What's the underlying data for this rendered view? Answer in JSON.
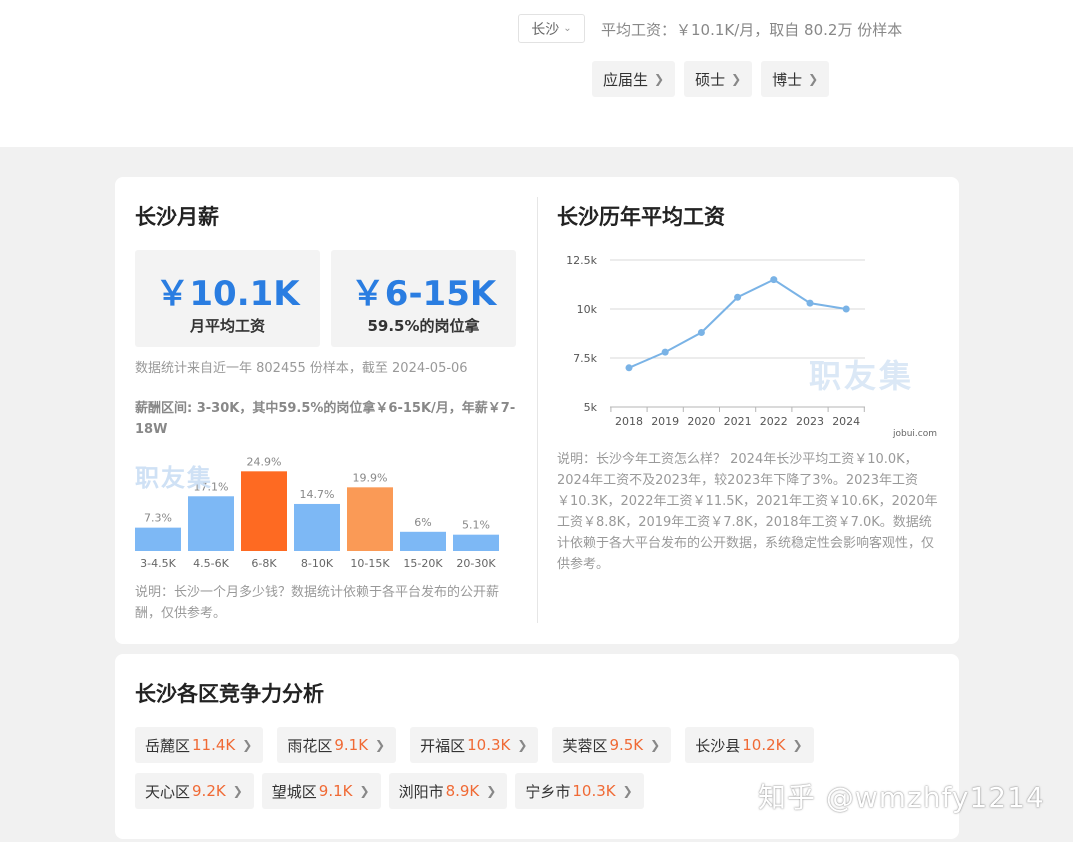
{
  "header": {
    "city": "长沙",
    "summary": "平均工资：￥10.1K/月，取自 80.2万 份样本",
    "filters": [
      "应届生",
      "硕士",
      "博士"
    ]
  },
  "monthly": {
    "title": "长沙月薪",
    "avg_value": "￥10.1K",
    "avg_label": "月平均工资",
    "range_value": "￥6-15K",
    "range_label": "59.5%的岗位拿",
    "source_note": "数据统计来自近一年 802455 份样本，截至 2024-05-06",
    "range_text": "薪酬区间: 3-30K，其中59.5%的岗位拿￥6-15K/月，年薪￥7-18W",
    "watermark": "职友集",
    "footnote": "说明：长沙一个月多少钱？数据统计依赖于各平台发布的公开薪酬，仅供参考。"
  },
  "history": {
    "title": "长沙历年平均工资",
    "watermark": "职友集",
    "source_label": "jobui.com",
    "note": "说明：长沙今年工资怎么样？ 2024年长沙平均工资￥10.0K，2024年工资不及2023年，较2023年下降了3%。2023年工资￥10.3K，2022年工资￥11.5K，2021年工资￥10.6K，2020年工资￥8.8K，2019年工资￥7.8K，2018年工资￥7.0K。数据统计依赖于各大平台发布的公开数据，系统稳定性会影响客观性，仅供参考。"
  },
  "chart_data": [
    {
      "type": "bar",
      "categories": [
        "3-4.5K",
        "4.5-6K",
        "6-8K",
        "8-10K",
        "10-15K",
        "15-20K",
        "20-30K"
      ],
      "values": [
        7.3,
        17.1,
        24.9,
        14.7,
        19.9,
        6,
        5.1
      ],
      "value_labels": [
        "7.3%",
        "17.1%",
        "24.9%",
        "14.7%",
        "19.9%",
        "6%",
        "5.1%"
      ],
      "colors": [
        "#7db8f5",
        "#7db8f5",
        "#fe6a22",
        "#7db8f5",
        "#fa9a56",
        "#7db8f5",
        "#7db8f5"
      ]
    },
    {
      "type": "line",
      "x": [
        "2018",
        "2019",
        "2020",
        "2021",
        "2022",
        "2023",
        "2024"
      ],
      "y": [
        7.0,
        7.8,
        8.8,
        10.6,
        11.5,
        10.3,
        10.0
      ],
      "ylim": [
        5,
        12.5
      ],
      "ytick_labels": [
        "5k",
        "7.5k",
        "10k",
        "12.5k"
      ],
      "ytick_values": [
        5,
        7.5,
        10,
        12.5
      ],
      "grid": true,
      "color": "#7ab3e6"
    }
  ],
  "districts": {
    "title": "长沙各区竞争力分析",
    "rows": [
      [
        {
          "name": "岳麓区",
          "salary": "11.4K"
        },
        {
          "name": "雨花区",
          "salary": "9.1K"
        },
        {
          "name": "开福区",
          "salary": "10.3K"
        },
        {
          "name": "芙蓉区",
          "salary": "9.5K"
        },
        {
          "name": "长沙县",
          "salary": "10.2K"
        }
      ],
      [
        {
          "name": "天心区",
          "salary": "9.2K"
        },
        {
          "name": "望城区",
          "salary": "9.1K"
        },
        {
          "name": "浏阳市",
          "salary": "8.9K"
        },
        {
          "name": "宁乡市",
          "salary": "10.3K"
        }
      ]
    ]
  },
  "watermark": "知乎 @wmzhfy1214"
}
